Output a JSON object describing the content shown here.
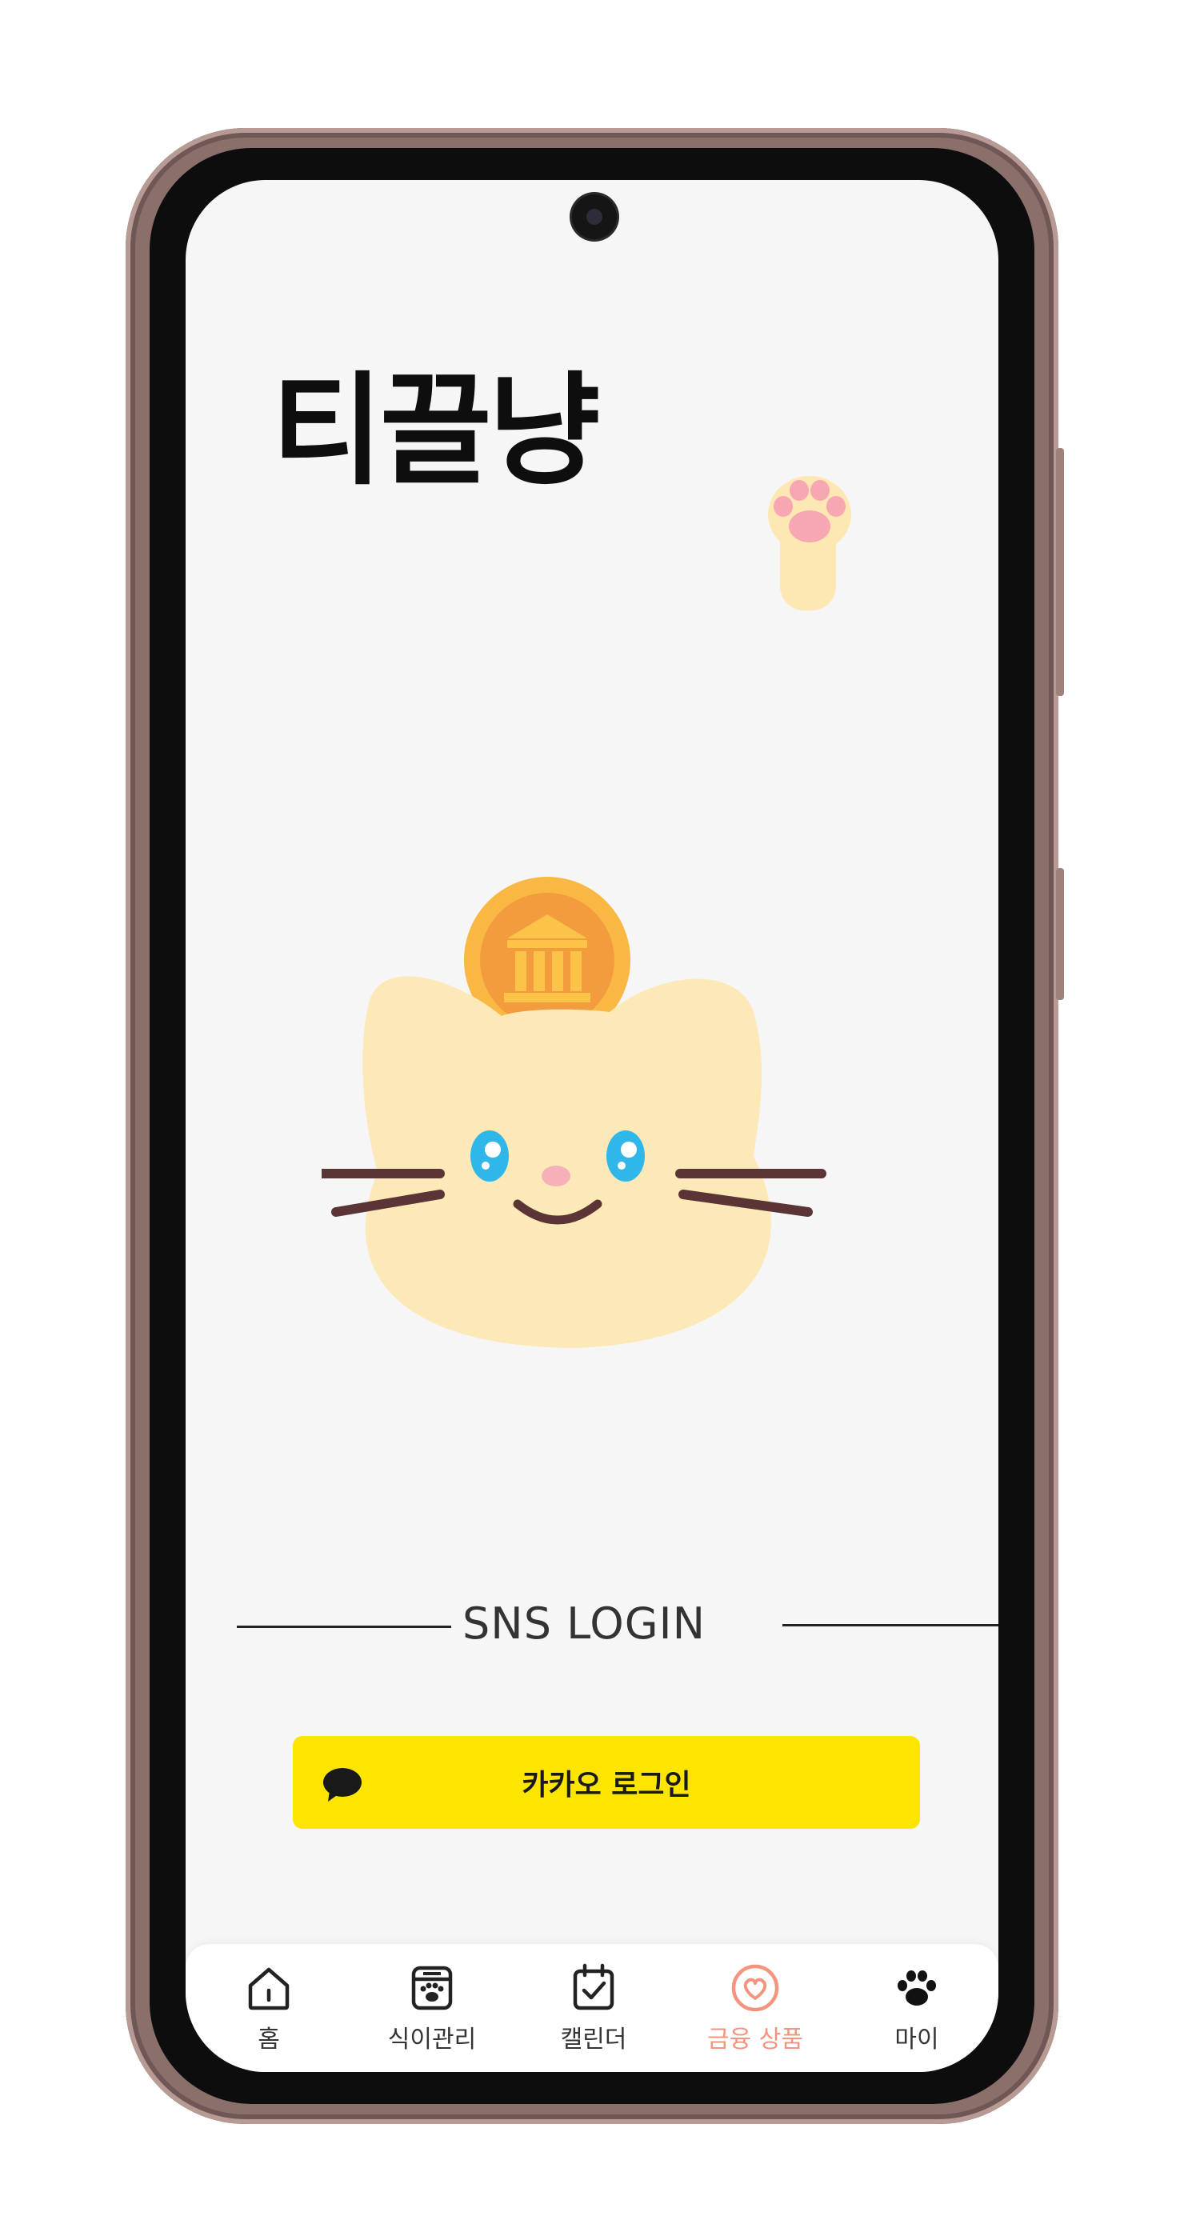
{
  "app": {
    "logo_text": "티끌냥"
  },
  "login": {
    "section_label": "SNS LOGIN",
    "kakao_button_label": "카카오 로그인",
    "kakao_color": "#fee500"
  },
  "tabbar": {
    "active_color": "#f4947f",
    "items": [
      {
        "label": "홈",
        "icon": "home-icon"
      },
      {
        "label": "식이관리",
        "icon": "food-bowl-icon"
      },
      {
        "label": "캘린더",
        "icon": "calendar-check-icon"
      },
      {
        "label": "금융 상품",
        "icon": "heart-circle-icon",
        "active": true
      },
      {
        "label": "마이",
        "icon": "paw-icon"
      }
    ]
  }
}
